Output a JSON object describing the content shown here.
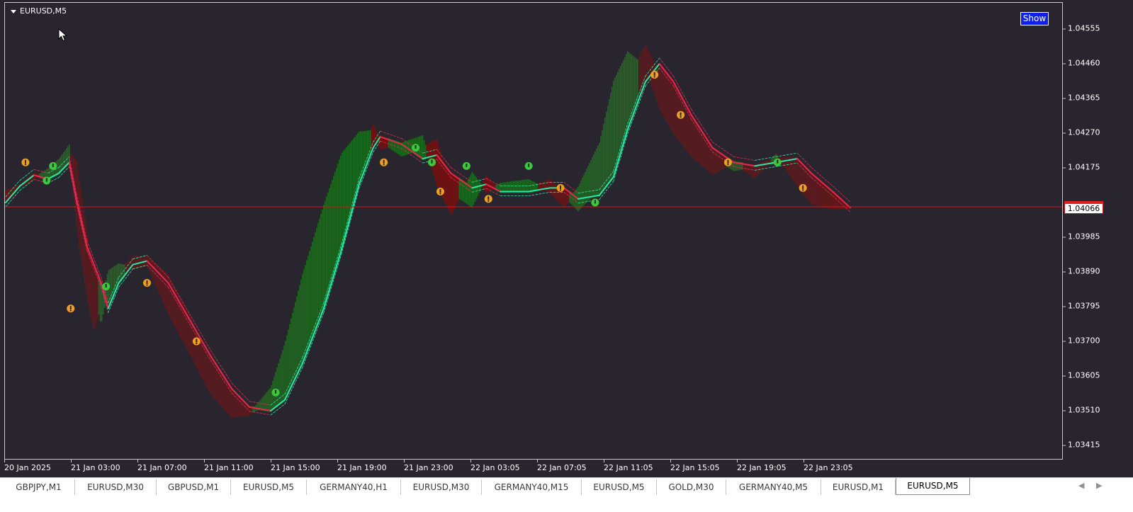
{
  "window": {
    "symbol_title": "EURUSD,M5",
    "show_button": "Show",
    "current_price": "1.04066"
  },
  "price_axis": [
    "1.04555",
    "1.04460",
    "1.04365",
    "1.04270",
    "1.04175",
    "1.03985",
    "1.03890",
    "1.03795",
    "1.03700",
    "1.03605",
    "1.03510",
    "1.03415"
  ],
  "time_axis": [
    "20 Jan 2025",
    "21 Jan 03:00",
    "21 Jan 07:00",
    "21 Jan 11:00",
    "21 Jan 15:00",
    "21 Jan 19:00",
    "21 Jan 23:00",
    "22 Jan 03:05",
    "22 Jan 07:05",
    "22 Jan 11:05",
    "22 Jan 15:05",
    "22 Jan 19:05",
    "22 Jan 23:05"
  ],
  "tabs": [
    "GBPJPY,M1",
    "EURUSD,M30",
    "GBPUSD,M1",
    "EURUSD,M5",
    "GERMANY40,H1",
    "EURUSD,M30",
    "GERMANY40,M15",
    "EURUSD,M5",
    "GOLD,M30",
    "GERMANY40,M5",
    "EURUSD,M1",
    "EURUSD,M5"
  ],
  "active_tab_index": 11,
  "colors": {
    "background": "#29252f",
    "bull_bars": "#1f6b1f",
    "bear_bars": "#6e1414",
    "ma_up": "#27e8a8",
    "ma_down": "#e8284e",
    "price_line": "#d01818",
    "signal_up": "#3cc83c",
    "signal_down": "#f0a020"
  },
  "chart_data": {
    "type": "line",
    "ylim": [
      1.0337,
      1.0461
    ],
    "x_count": 1195,
    "ma": [
      [
        0,
        1.0408
      ],
      [
        20,
        1.04125
      ],
      [
        40,
        1.04155
      ],
      [
        60,
        1.04145
      ],
      [
        75,
        1.0416
      ],
      [
        90,
        1.0419
      ],
      [
        100,
        1.0409
      ],
      [
        115,
        1.0396
      ],
      [
        135,
        1.0386
      ],
      [
        145,
        1.0379
      ],
      [
        160,
        1.0386
      ],
      [
        180,
        1.0391
      ],
      [
        200,
        1.0392
      ],
      [
        230,
        1.0386
      ],
      [
        260,
        1.0376
      ],
      [
        290,
        1.0366
      ],
      [
        320,
        1.0357
      ],
      [
        345,
        1.0352
      ],
      [
        375,
        1.0351
      ],
      [
        395,
        1.0354
      ],
      [
        420,
        1.0364
      ],
      [
        450,
        1.0379
      ],
      [
        475,
        1.0395
      ],
      [
        500,
        1.0413
      ],
      [
        520,
        1.0423
      ],
      [
        530,
        1.0426
      ],
      [
        560,
        1.0424
      ],
      [
        590,
        1.042
      ],
      [
        610,
        1.0421
      ],
      [
        630,
        1.0416
      ],
      [
        660,
        1.0412
      ],
      [
        680,
        1.0413
      ],
      [
        700,
        1.0411
      ],
      [
        740,
        1.0411
      ],
      [
        770,
        1.0412
      ],
      [
        790,
        1.0412
      ],
      [
        810,
        1.0409
      ],
      [
        840,
        1.041
      ],
      [
        860,
        1.0415
      ],
      [
        880,
        1.0428
      ],
      [
        905,
        1.0441
      ],
      [
        925,
        1.0446
      ],
      [
        945,
        1.0441
      ],
      [
        970,
        1.0432
      ],
      [
        1000,
        1.0423
      ],
      [
        1030,
        1.0419
      ],
      [
        1060,
        1.0418
      ],
      [
        1090,
        1.0419
      ],
      [
        1120,
        1.042
      ],
      [
        1140,
        1.0416
      ],
      [
        1170,
        1.0411
      ],
      [
        1195,
        1.04066
      ]
    ],
    "bars": [
      [
        0,
        1.0411,
        1.0408
      ],
      [
        20,
        1.04125,
        1.04125
      ],
      [
        40,
        1.0416,
        1.04145
      ],
      [
        60,
        1.0414,
        1.0417
      ],
      [
        75,
        1.0417,
        1.04195
      ],
      [
        90,
        1.04215,
        1.04235
      ],
      [
        100,
        1.0419,
        1.04015
      ],
      [
        115,
        1.04,
        1.0382
      ],
      [
        125,
        1.0384,
        1.0373
      ],
      [
        135,
        1.0375,
        1.038
      ],
      [
        145,
        1.0384,
        1.0389
      ],
      [
        160,
        1.0389,
        1.0391
      ],
      [
        180,
        1.0393,
        1.039
      ],
      [
        200,
        1.0393,
        1.0391
      ],
      [
        230,
        1.0388,
        1.0378
      ],
      [
        260,
        1.0377,
        1.0367
      ],
      [
        290,
        1.0364,
        1.0356
      ],
      [
        320,
        1.0357,
        1.03495
      ],
      [
        345,
        1.03505,
        1.035
      ],
      [
        375,
        1.0353,
        1.0357
      ],
      [
        395,
        1.0357,
        1.0369
      ],
      [
        420,
        1.0369,
        1.0388
      ],
      [
        450,
        1.0388,
        1.0407
      ],
      [
        475,
        1.0407,
        1.0421
      ],
      [
        500,
        1.042,
        1.0427
      ],
      [
        520,
        1.0429,
        1.04275
      ],
      [
        530,
        1.0425,
        1.0423
      ],
      [
        560,
        1.0421,
        1.0424
      ],
      [
        590,
        1.0423,
        1.0426
      ],
      [
        610,
        1.0425,
        1.0413
      ],
      [
        630,
        1.0411,
        1.0405
      ],
      [
        660,
        1.0407,
        1.0416
      ],
      [
        680,
        1.0415,
        1.0411
      ],
      [
        700,
        1.0411,
        1.0413
      ],
      [
        740,
        1.0412,
        1.0414
      ],
      [
        770,
        1.0414,
        1.0411
      ],
      [
        790,
        1.041,
        1.0407
      ],
      [
        810,
        1.0406,
        1.0412
      ],
      [
        840,
        1.0412,
        1.0424
      ],
      [
        860,
        1.0424,
        1.0441
      ],
      [
        880,
        1.0441,
        1.0449
      ],
      [
        905,
        1.0451,
        1.0445
      ],
      [
        925,
        1.0443,
        1.0434
      ],
      [
        945,
        1.0434,
        1.0427
      ],
      [
        970,
        1.0426,
        1.0421
      ],
      [
        1000,
        1.0421,
        1.0416
      ],
      [
        1030,
        1.0417,
        1.0419
      ],
      [
        1060,
        1.0418,
        1.0415
      ],
      [
        1090,
        1.042,
        1.0421
      ],
      [
        1120,
        1.042,
        1.0413
      ],
      [
        1140,
        1.0413,
        1.0408
      ],
      [
        1170,
        1.0408,
        1.04066
      ],
      [
        1195,
        1.04066,
        1.04066
      ]
    ],
    "signals": [
      {
        "x": 28,
        "price": 1.0419,
        "dir": "down"
      },
      {
        "x": 58,
        "price": 1.0414,
        "dir": "up"
      },
      {
        "x": 67,
        "price": 1.0418,
        "dir": "up"
      },
      {
        "x": 92,
        "price": 1.0379,
        "dir": "down"
      },
      {
        "x": 142,
        "price": 1.0385,
        "dir": "up"
      },
      {
        "x": 200,
        "price": 1.0386,
        "dir": "down"
      },
      {
        "x": 270,
        "price": 1.037,
        "dir": "down"
      },
      {
        "x": 382,
        "price": 1.0356,
        "dir": "up"
      },
      {
        "x": 535,
        "price": 1.0419,
        "dir": "down"
      },
      {
        "x": 580,
        "price": 1.0423,
        "dir": "up"
      },
      {
        "x": 603,
        "price": 1.0419,
        "dir": "up"
      },
      {
        "x": 615,
        "price": 1.0411,
        "dir": "down"
      },
      {
        "x": 652,
        "price": 1.0418,
        "dir": "up"
      },
      {
        "x": 683,
        "price": 1.0409,
        "dir": "down"
      },
      {
        "x": 740,
        "price": 1.0418,
        "dir": "up"
      },
      {
        "x": 785,
        "price": 1.0412,
        "dir": "down"
      },
      {
        "x": 834,
        "price": 1.0408,
        "dir": "up"
      },
      {
        "x": 918,
        "price": 1.0443,
        "dir": "down"
      },
      {
        "x": 955,
        "price": 1.0432,
        "dir": "down"
      },
      {
        "x": 1022,
        "price": 1.0419,
        "dir": "down"
      },
      {
        "x": 1092,
        "price": 1.0419,
        "dir": "up"
      },
      {
        "x": 1128,
        "price": 1.0412,
        "dir": "down"
      }
    ]
  }
}
